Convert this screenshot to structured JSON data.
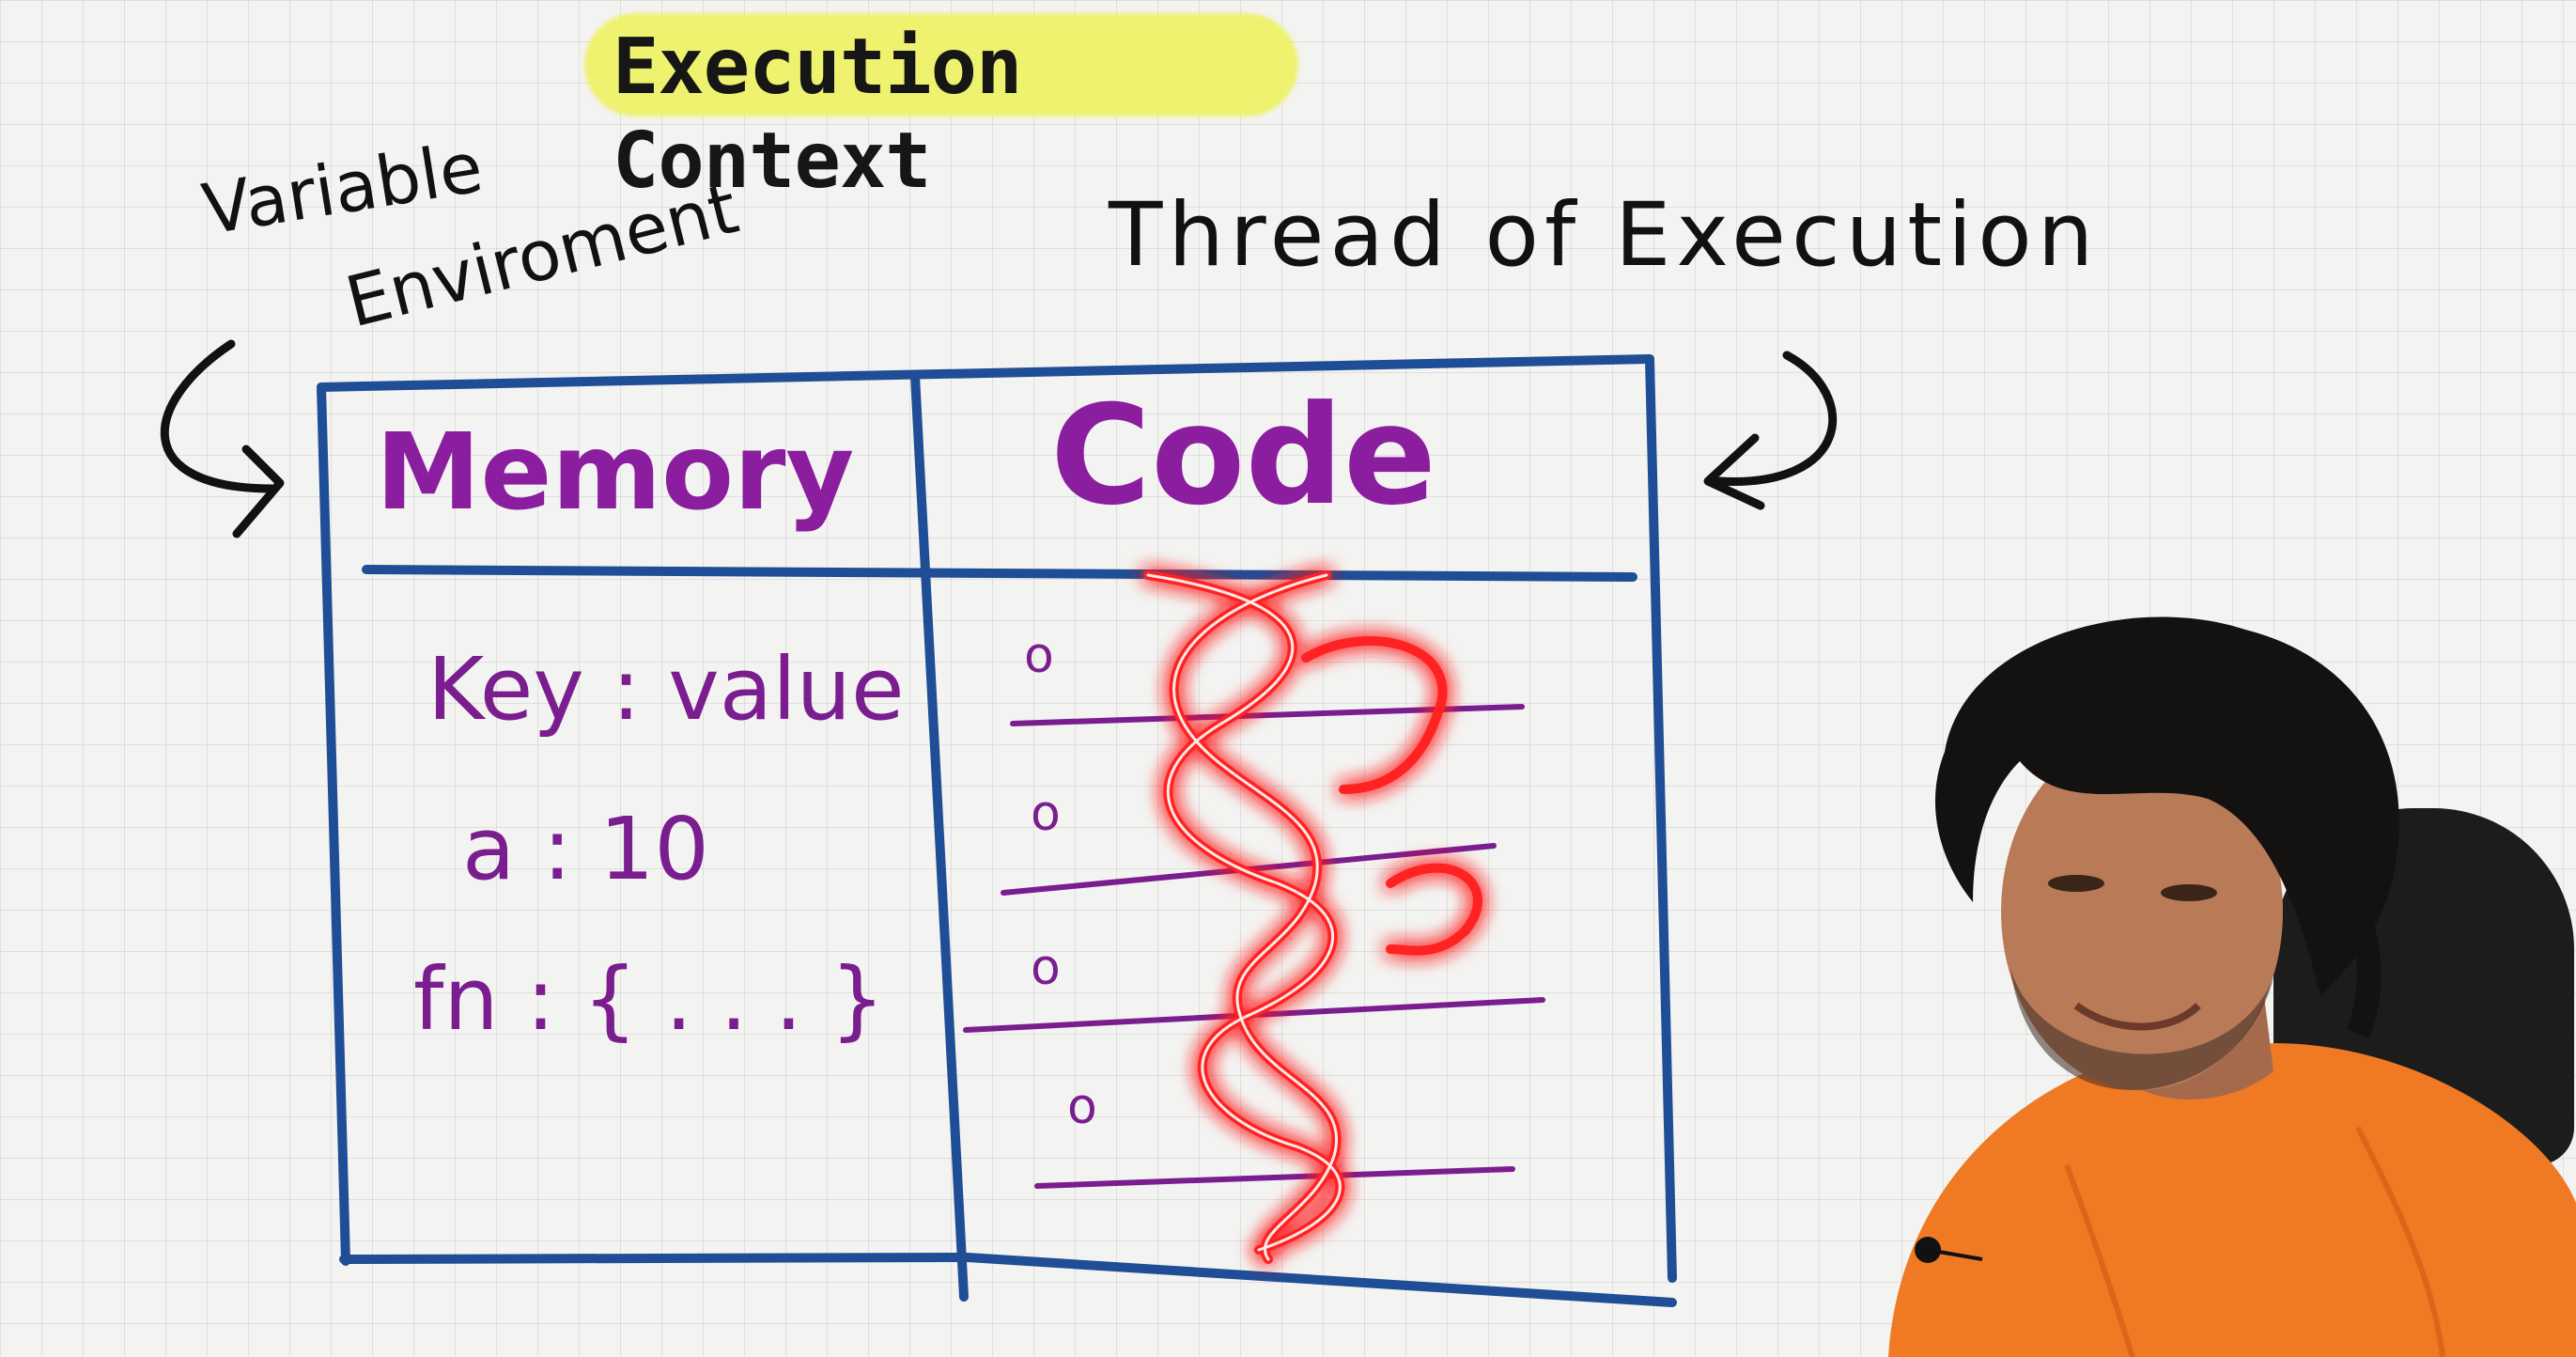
{
  "title": "Execution Context",
  "labels": {
    "variable": "Variable",
    "environment": "Enviroment",
    "thread": "Thread of Execution"
  },
  "table": {
    "memory_header": "Memory",
    "code_header": "Code",
    "memory_rows": [
      {
        "text": "Key : value"
      },
      {
        "text": "a : 10"
      },
      {
        "text": "fn : { . . . }"
      }
    ],
    "code_line_marker": "o"
  },
  "colors": {
    "highlight": "#eef262",
    "table_border": "#1f4e96",
    "header_purple": "#8b1e9f",
    "content_purple": "#7a1d8f",
    "thread_glow": "#ff1a1a",
    "shirt": "#ef7a23"
  }
}
